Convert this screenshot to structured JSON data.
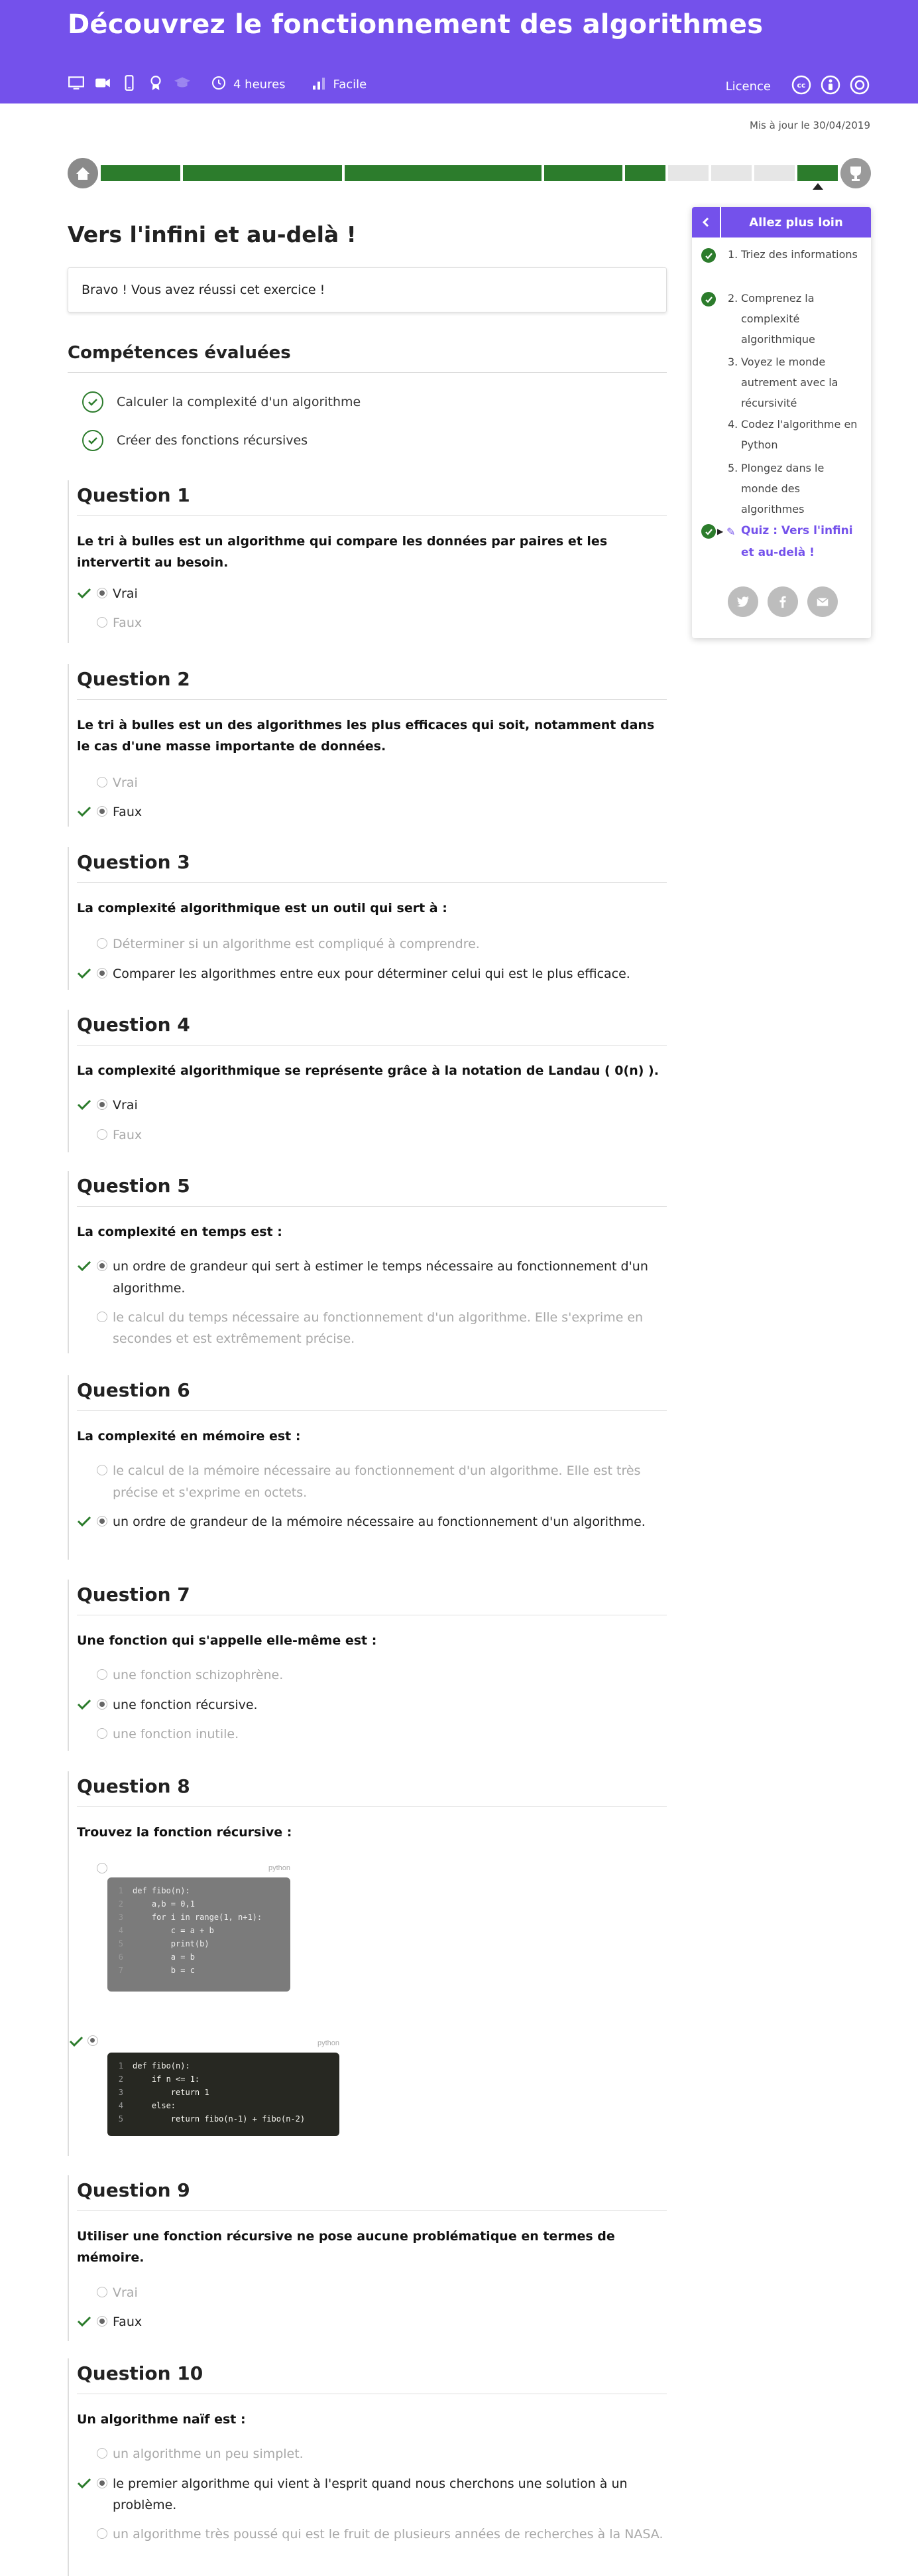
{
  "header": {
    "title": "Découvrez le fonctionnement des algorithmes",
    "duration": "4 heures",
    "level": "Facile",
    "licence_label": "Licence",
    "media_icons": [
      "monitor-icon",
      "video-icon",
      "mobile-icon",
      "certificate-icon",
      "graduation-cap-icon"
    ],
    "licence_icons": [
      "cc-icon",
      "by-icon",
      "sa-icon"
    ]
  },
  "updated": "Mis à jour le 30/04/2019",
  "progress": {
    "segments": [
      "done",
      "done",
      "done",
      "done",
      "done",
      "todo",
      "todo",
      "todo",
      "done"
    ],
    "current_index": 8
  },
  "page": {
    "title": "Vers l'infini et au-delà !",
    "success_message": "Bravo ! Vous avez réussi cet exercice !",
    "skills_title": "Compétences évaluées",
    "skills": [
      "Calculer la complexité d'un algorithme",
      "Créer des fonctions récursives"
    ]
  },
  "questions": [
    {
      "title": "Question 1",
      "text": "Le tri à bulles est un algorithme qui compare les données par paires et les intervertit au besoin.",
      "options": [
        {
          "label": "Vrai",
          "selected": true,
          "correct": true
        },
        {
          "label": "Faux",
          "selected": false,
          "correct": false
        }
      ]
    },
    {
      "title": "Question 2",
      "text": "Le tri à bulles est un des algorithmes les plus efficaces qui soit, notamment dans le cas d'une masse importante de données.",
      "options": [
        {
          "label": "Vrai",
          "selected": false,
          "correct": false
        },
        {
          "label": "Faux",
          "selected": true,
          "correct": true
        }
      ]
    },
    {
      "title": "Question 3",
      "text": "La complexité algorithmique est un outil qui sert à :",
      "options": [
        {
          "label": "Déterminer si un algorithme est compliqué à comprendre.",
          "selected": false,
          "correct": false
        },
        {
          "label": "Comparer les algorithmes entre eux pour déterminer celui qui est le plus efficace.",
          "selected": true,
          "correct": true
        }
      ]
    },
    {
      "title": "Question 4",
      "text": "La complexité algorithmique se représente grâce à la notation de Landau ( 0(n) ).",
      "options": [
        {
          "label": "Vrai",
          "selected": true,
          "correct": true
        },
        {
          "label": "Faux",
          "selected": false,
          "correct": false
        }
      ]
    },
    {
      "title": "Question 5",
      "text": "La complexité en temps est :",
      "options": [
        {
          "label": "un ordre de grandeur qui sert à estimer le temps nécessaire au fonctionnement d'un algorithme.",
          "selected": true,
          "correct": true
        },
        {
          "label": "le calcul du temps nécessaire au fonctionnement d'un algorithme. Elle s'exprime en secondes et est extrêmement précise.",
          "selected": false,
          "correct": false
        }
      ]
    },
    {
      "title": "Question 6",
      "text": "La complexité en mémoire est :",
      "options": [
        {
          "label": "le calcul de la mémoire nécessaire au fonctionnement d'un algorithme. Elle est très précise et s'exprime en octets.",
          "selected": false,
          "correct": false
        },
        {
          "label": "un ordre de grandeur de la mémoire nécessaire au fonctionnement d'un algorithme.",
          "selected": true,
          "correct": true
        }
      ]
    },
    {
      "title": "Question 7",
      "text": "Une fonction qui s'appelle elle-même est :",
      "options": [
        {
          "label": "une fonction schizophrène.",
          "selected": false,
          "correct": false
        },
        {
          "label": "une fonction récursive.",
          "selected": true,
          "correct": true
        },
        {
          "label": "une fonction inutile.",
          "selected": false,
          "correct": false
        }
      ]
    },
    {
      "title": "Question 8",
      "text": "Trouvez la fonction récursive :",
      "code_lang": "python",
      "code_a": [
        "def fibo(n):",
        "    a,b = 0,1",
        "    for i in range(1, n+1):",
        "        c = a + b",
        "        print(b)",
        "        a = b",
        "        b = c"
      ],
      "code_b": [
        "def fibo(n):",
        "    if n <= 1:",
        "        return 1",
        "    else:",
        "        return fibo(n-1) + fibo(n-2)"
      ]
    },
    {
      "title": "Question 9",
      "text": "Utiliser une fonction récursive ne pose aucune problématique en termes de mémoire.",
      "options": [
        {
          "label": "Vrai",
          "selected": false,
          "correct": false
        },
        {
          "label": "Faux",
          "selected": true,
          "correct": true
        }
      ]
    },
    {
      "title": "Question 10",
      "text": "Un algorithme naïf est :",
      "options": [
        {
          "label": "un algorithme un peu simplet.",
          "selected": false,
          "correct": false
        },
        {
          "label": "le premier algorithme qui vient à l'esprit quand nous cherchons une solution à un problème.",
          "selected": true,
          "correct": true
        },
        {
          "label": "un algorithme très poussé qui est le fruit de plusieurs années de recherches à la NASA.",
          "selected": false,
          "correct": false
        }
      ]
    }
  ],
  "sidebar": {
    "title": "Allez plus loin",
    "chapters": [
      {
        "num": "1.",
        "label": "Triez des informations",
        "done": true
      },
      {
        "num": "2.",
        "label": "Comprenez la complexité algorithmique",
        "done": true
      },
      {
        "num": "3.",
        "label": "Voyez le monde autrement avec la récursivité",
        "done": false
      },
      {
        "num": "4.",
        "label": "Codez l'algorithme en Python",
        "done": false
      },
      {
        "num": "5.",
        "label": "Plongez dans le monde des algorithmes",
        "done": false
      },
      {
        "num": "",
        "label": "Quiz : Vers l'infini et au-delà !",
        "done": true,
        "current": true
      }
    ],
    "share_icons": [
      "twitter-icon",
      "facebook-icon",
      "email-icon"
    ]
  }
}
